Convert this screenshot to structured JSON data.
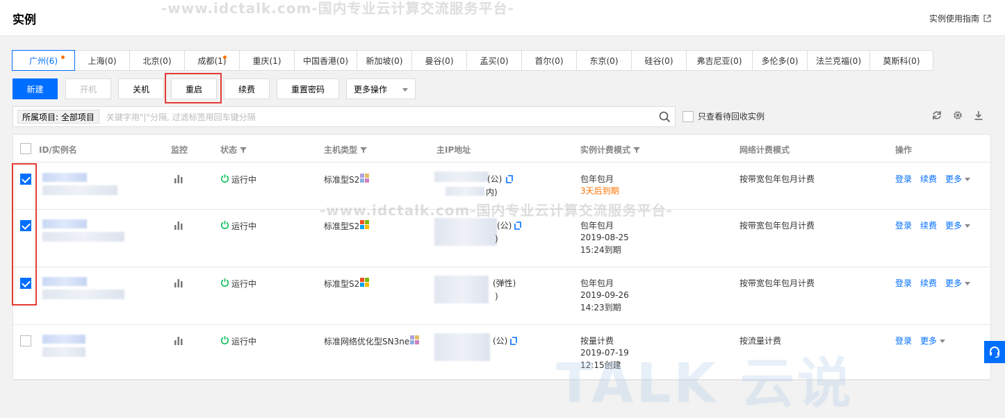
{
  "header": {
    "title": "实例",
    "guide_label": "实例使用指南"
  },
  "watermark": {
    "text": "-www.idctalk.com-国内专业云计算交流服务平台-",
    "logo": "TALK 云说"
  },
  "regions": [
    {
      "label": "广州(6)",
      "active": true,
      "dot": true
    },
    {
      "label": "上海(0)"
    },
    {
      "label": "北京(0)"
    },
    {
      "label": "成都(1)",
      "dot": true
    },
    {
      "label": "重庆(1)"
    },
    {
      "label": "中国香港(0)"
    },
    {
      "label": "新加坡(0)"
    },
    {
      "label": "曼谷(0)"
    },
    {
      "label": "孟买(0)"
    },
    {
      "label": "首尔(0)"
    },
    {
      "label": "东京(0)"
    },
    {
      "label": "硅谷(0)"
    },
    {
      "label": "弗吉尼亚(0)"
    },
    {
      "label": "多伦多(0)"
    },
    {
      "label": "法兰克福(0)"
    },
    {
      "label": "莫斯科(0)"
    }
  ],
  "toolbar": {
    "new": "新建",
    "start": "开机",
    "shutdown": "关机",
    "restart": "重启",
    "renew": "续费",
    "reset_password": "重置密码",
    "more_ops": "更多操作"
  },
  "search": {
    "project_tag": "所属项目: 全部项目",
    "placeholder": "关键字用\"|\"分隔, 过滤标签用回车键分隔",
    "recycle_label": "只查看待回收实例"
  },
  "table": {
    "headers": {
      "id": "ID/实例名",
      "monitor": "监控",
      "status": "状态",
      "host_type": "主机类型",
      "ip": "主IP地址",
      "billing": "实例计费模式",
      "net_billing": "网络计费模式",
      "ops": "操作"
    },
    "rows": [
      {
        "checked": true,
        "status": "运行中",
        "host_type": "标准型S2",
        "ip_suffix": "(公)",
        "ip_suffix2": "内)",
        "billing_line1": "包年包月",
        "billing_line2": "3天后到期",
        "billing_line3": "",
        "net_billing": "按带宽包年包月计费",
        "op_login": "登录",
        "op_renew": "续费",
        "op_more": "更多"
      },
      {
        "checked": true,
        "status": "运行中",
        "host_type": "标准型S2",
        "ip_suffix": "(公)",
        "ip_suffix2": ")",
        "billing_line1": "包年包月",
        "billing_line2": "2019-08-25",
        "billing_line3": "15:24到期",
        "net_billing": "按带宽包年包月计费",
        "op_login": "登录",
        "op_renew": "续费",
        "op_more": "更多"
      },
      {
        "checked": true,
        "status": "运行中",
        "host_type": "标准型S2",
        "ip_suffix": "(弹性)",
        "ip_suffix2": ")",
        "billing_line1": "包年包月",
        "billing_line2": "2019-09-26",
        "billing_line3": "14:23到期",
        "net_billing": "按带宽包年包月计费",
        "op_login": "登录",
        "op_renew": "续费",
        "op_more": "更多"
      },
      {
        "checked": false,
        "status": "运行中",
        "host_type": "标准网络优化型SN3ne",
        "ip_suffix": "(公)",
        "ip_suffix2": "",
        "billing_line1": "按量计费",
        "billing_line2": "2019-07-19",
        "billing_line3": "12:15创建",
        "net_billing": "按流量计费",
        "op_login": "登录",
        "op_renew": "",
        "op_more": "更多"
      }
    ]
  },
  "colors": {
    "primary": "#006eff",
    "running": "#0abf5b",
    "warning": "#ff7200",
    "highlight": "#e53935"
  }
}
